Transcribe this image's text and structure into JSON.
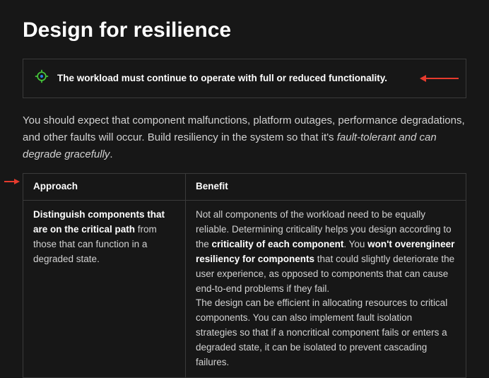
{
  "heading": "Design for resilience",
  "callout_text": "The workload must continue to operate with full or reduced functionality.",
  "intro": {
    "part1": "You should expect that component malfunctions, platform outages, performance degradations, and other faults will occur. Build resiliency in the system so that it's ",
    "em": "fault-tolerant and can degrade gracefully",
    "end": "."
  },
  "table": {
    "headers": {
      "approach": "Approach",
      "benefit": "Benefit"
    },
    "rows": [
      {
        "approach_bold": "Distinguish components that are on the critical path",
        "approach_rest": " from those that can function in a degraded state.",
        "benefit": {
          "p1a": "Not all components of the workload need to be equally reliable. Determining criticality helps you design according to the ",
          "p1b_bold": "criticality of each component",
          "p1c": ". You ",
          "p1d_bold": "won't overengineer resiliency for components",
          "p1e": " that could slightly deteriorate the user experience, as opposed to components that can cause end-to-end problems if they fail.",
          "p2": "The design can be efficient in allocating resources to critical components. You can also implement fault isolation strategies so that if a noncritical component fails or enters a degraded state, it can be isolated to prevent cascading failures."
        }
      }
    ]
  }
}
